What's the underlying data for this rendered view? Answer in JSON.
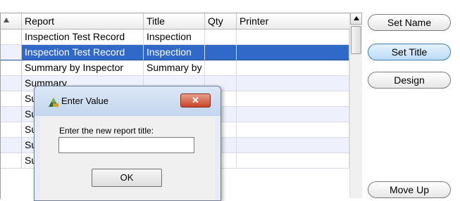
{
  "grid": {
    "columns": [
      {
        "label": "Report"
      },
      {
        "label": "Title"
      },
      {
        "label": "Qty"
      },
      {
        "label": "Printer"
      }
    ],
    "rows": [
      {
        "report": "Inspection Test Record",
        "title": "Inspection",
        "qty": "",
        "printer": ""
      },
      {
        "report": "Inspection Test Record",
        "title": "Inspection",
        "qty": "",
        "printer": ""
      },
      {
        "report": "Summary by Inspector",
        "title": "Summary by",
        "qty": "",
        "printer": ""
      },
      {
        "report": "Summary",
        "title": "",
        "qty": "",
        "printer": ""
      },
      {
        "report": "Summary",
        "title": "",
        "qty": "",
        "printer": ""
      },
      {
        "report": "Summary",
        "title": "",
        "qty": "",
        "printer": ""
      },
      {
        "report": "Summary",
        "title": "",
        "qty": "",
        "printer": ""
      },
      {
        "report": "Summary",
        "title": "",
        "qty": "",
        "printer": ""
      },
      {
        "report": "Summary",
        "title": "",
        "qty": "",
        "printer": ""
      }
    ],
    "selected_row": 1
  },
  "buttons": {
    "set_name": "Set Name",
    "set_title": "Set Title",
    "design": "Design",
    "move_up": "Move Up"
  },
  "dialog": {
    "title": "Enter Value",
    "close_glyph": "✕",
    "prompt": "Enter the new report title:",
    "input_value": "",
    "ok": "OK"
  },
  "icons": {
    "dialog_icon": "app-icon",
    "sort_indicator": "sort-ascending-icon",
    "scroll_up": "scroll-up-arrow-icon"
  }
}
